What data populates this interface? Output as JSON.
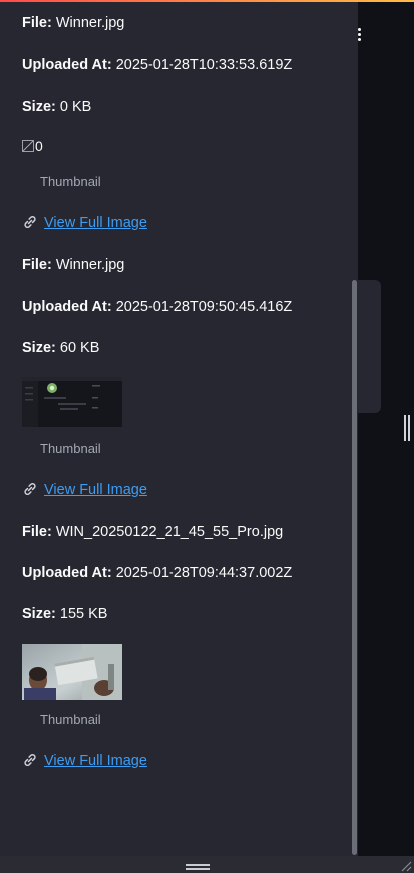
{
  "entries": [
    {
      "file_label": "File:",
      "file_value": "Winner.jpg",
      "uploaded_label": "Uploaded At:",
      "uploaded_value": "2025-01-28T10:33:53.619Z",
      "size_label": "Size:",
      "size_value": "0 KB",
      "thumb_alt": "0",
      "caption": "Thumbnail",
      "link_text": "View Full Image"
    },
    {
      "file_label": "File:",
      "file_value": "Winner.jpg",
      "uploaded_label": "Uploaded At:",
      "uploaded_value": "2025-01-28T09:50:45.416Z",
      "size_label": "Size:",
      "size_value": "60 KB",
      "caption": "Thumbnail",
      "link_text": "View Full Image"
    },
    {
      "file_label": "File:",
      "file_value": "WIN_20250122_21_45_55_Pro.jpg",
      "uploaded_label": "Uploaded At:",
      "uploaded_value": "2025-01-28T09:44:37.002Z",
      "size_label": "Size:",
      "size_value": "155 KB",
      "caption": "Thumbnail",
      "link_text": "View Full Image"
    }
  ],
  "icons": {
    "menu": "kebab-menu-icon",
    "link": "link-icon",
    "resize": "resize-grip-icon"
  },
  "colors": {
    "sidebar_bg": "#262730",
    "app_bg": "#0f1116",
    "link": "#3d9df3",
    "caption": "#a3a8b4"
  }
}
